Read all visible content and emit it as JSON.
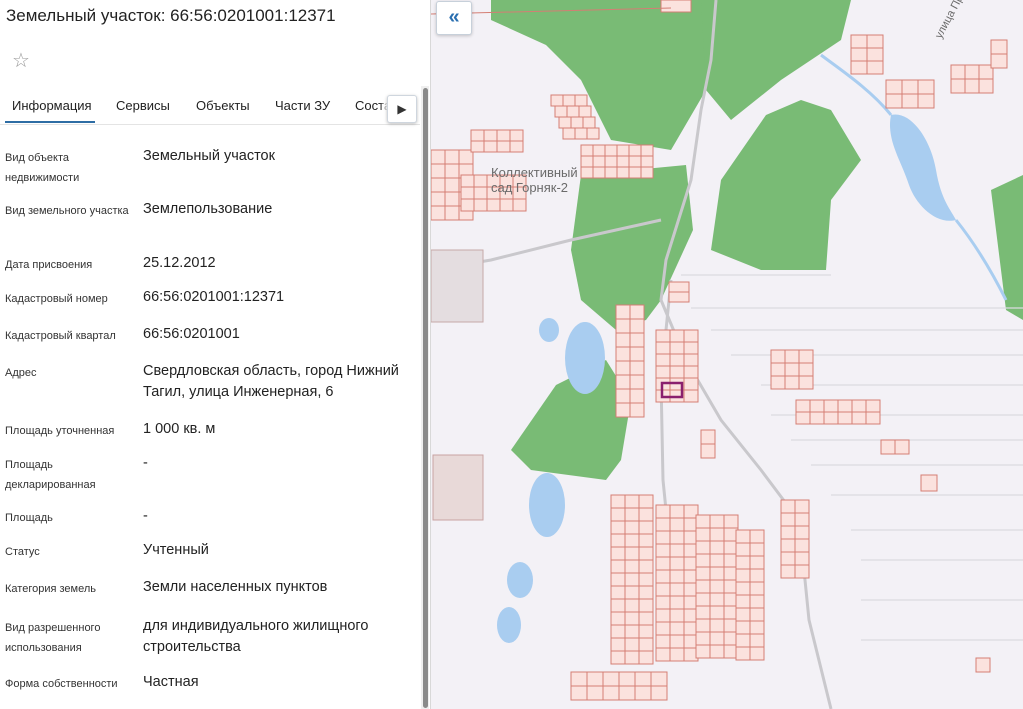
{
  "panel": {
    "title": "Земельный участок: 66:56:0201001:12371",
    "favorite_icon": "star-icon",
    "tabs": [
      {
        "label": "Информация",
        "active": true
      },
      {
        "label": "Сервисы"
      },
      {
        "label": "Объекты"
      },
      {
        "label": "Части ЗУ"
      },
      {
        "label": "Соста"
      }
    ],
    "tabs_scroll_icon": "chevron-right-icon",
    "properties": [
      {
        "label": "Вид объекта недвижимости",
        "value": "Земельный участок"
      },
      {
        "label": "Вид земельного участка",
        "value": "Землепользование"
      },
      {
        "label": "Дата присвоения",
        "value": "25.12.2012"
      },
      {
        "label": "Кадастровый номер",
        "value": "66:56:0201001:12371"
      },
      {
        "label": "Кадастровый квартал",
        "value": "66:56:0201001"
      },
      {
        "label": "Адрес",
        "value": "Свердловская область, город Нижний Тагил, улица Инженерная, 6"
      },
      {
        "label": "Площадь уточненная",
        "value": "1 000 кв. м"
      },
      {
        "label": "Площадь декларированная",
        "value": "-"
      },
      {
        "label": "Площадь",
        "value": "-"
      },
      {
        "label": "Статус",
        "value": "Учтенный"
      },
      {
        "label": "Категория земель",
        "value": "Земли населенных пунктов"
      },
      {
        "label": "Вид разрешенного использования",
        "value": "для индивидуального жилищного строительства"
      },
      {
        "label": "Форма собственности",
        "value": "Частная"
      }
    ]
  },
  "map": {
    "collapse_icon": "double-chevron-left-icon",
    "collapse_label": "«",
    "labels": {
      "settlement_line1": "Коллективный",
      "settlement_line2": "сад Горняк-2",
      "street": "улица Продольная"
    },
    "colors": {
      "background": "#f3f1f6",
      "forest": "#79bb75",
      "water": "#a9cdf0",
      "parcel_fill": "#fbe2de",
      "parcel_stroke": "#d47e74",
      "selected_parcel": "#8a1f6e"
    }
  }
}
